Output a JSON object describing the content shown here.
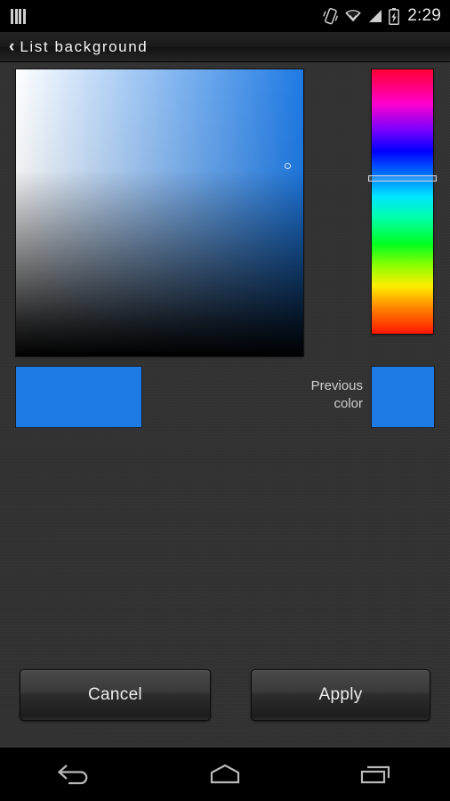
{
  "statusbar": {
    "notification_icon": "signal-bars-icon",
    "vibrate_icon": "vibrate-icon",
    "wifi_icon": "wifi-icon",
    "cellular_icon": "cellular-signal-icon",
    "battery_icon": "battery-charging-icon",
    "time": "2:29"
  },
  "actionbar": {
    "back_chevron": "‹",
    "title": "List background"
  },
  "picker": {
    "sv_square_name": "saturation-value-square",
    "hue_slider_name": "hue-slider",
    "selected_color": "#1E7AE4",
    "previous_color": "#1E7AE4",
    "previous_label_line1": "Previous",
    "previous_label_line2": "color",
    "hue_degrees": 211,
    "saturation_percent": 87,
    "value_percent": 89
  },
  "buttons": {
    "cancel": "Cancel",
    "apply": "Apply"
  },
  "navbar": {
    "back": "back-icon",
    "home": "home-icon",
    "recents": "recents-icon"
  }
}
